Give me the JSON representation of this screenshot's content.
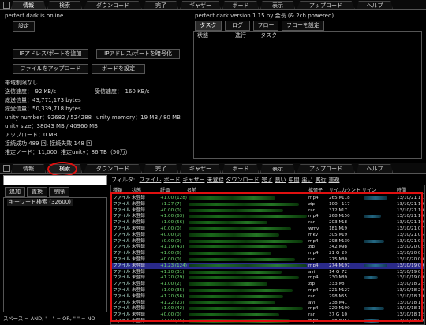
{
  "top_tabs": [
    "情報",
    "検索",
    "ダウンロード",
    "完了",
    "ギャザー",
    "ボード",
    "表示",
    "アップロード",
    "ヘルプ"
  ],
  "left_panel": {
    "status": "perfect dark is online.",
    "settings_button": "設定",
    "btn_add_ip": "IPアドレス/ポートを追加",
    "btn_encrypt_ip": "IPアドレス/ポートを暗号化",
    "btn_upload_file": "ファイルをアップロード",
    "btn_board_settings": "ボードを設定",
    "bandwidth": "帯域制限なし",
    "send_speed": "送信速度：　92 KB/s",
    "recv_speed": "受信速度：　160 KB/s",
    "total_sent": "総送信量：43,771,173 bytes",
    "total_recv": "総受信量：50,339,718 bytes",
    "unity_number": "unity number：92682 / 524288",
    "unity_memory": "unity memory：19 MB / 80 MB",
    "unity_size": "unity size：38043 MB / 40960 MB",
    "upload": "アップロード：0 MB",
    "connections": "接続成功 489 回, 接続失敗 148 回",
    "estimate": "推定ノード：11,000, 推定unity：86 TB（50万）"
  },
  "right_panel": {
    "version": "perfect dark version 1.15 by 金長 (& 2ch powered)",
    "tabs": [
      "タスク",
      "ログ",
      "フロー",
      "フローを設定"
    ],
    "columns": [
      "状態",
      "進行",
      "タスク"
    ]
  },
  "bottom_tabs": [
    "情報",
    "検索",
    "ダウンロード",
    "完了",
    "ギャザー",
    "ボード",
    "表示",
    "アップロード",
    "ヘルプ"
  ],
  "search_panel": {
    "buttons": [
      "追加",
      "置換",
      "削除"
    ],
    "keyword_item": "キーワード検索 (32600)",
    "hint": "スペース = AND, \" | \" = OR, \" \" = NO"
  },
  "filter_bar": {
    "label": "フィルタ:",
    "items": [
      "ファイル",
      "ボード",
      "ギャザー",
      "未登録",
      "ダウンロード",
      "完了",
      "良い",
      "中間",
      "悪い",
      "実行",
      "重複"
    ]
  },
  "columns": [
    "種類",
    "状態",
    "評価",
    "名前",
    "拡張子",
    "サイ..",
    "カウント",
    "サイン",
    "時間"
  ],
  "rows": [
    {
      "k": "ファイル",
      "s": "未登録",
      "r": "+1.00 (128)",
      "e": "mp4",
      "sz": "265 M",
      "c": "118",
      "t": "13/10/21 11:0"
    },
    {
      "k": "ファイル",
      "s": "未登録",
      "r": "+1.27 (7)",
      "e": "zip",
      "sz": "100",
      "c": "117",
      "t": "13/10/21 10:4"
    },
    {
      "k": "ファイル",
      "s": "未登録",
      "r": "+0.00 (0)",
      "e": "rar",
      "sz": "312 M",
      "c": "17",
      "t": "13/10/21 10:0"
    },
    {
      "k": "ファイル",
      "s": "未登録",
      "r": "+1.00 (63)",
      "e": "mp4",
      "sz": "268 M",
      "c": "150",
      "t": "13/10/21 10:0"
    },
    {
      "k": "ファイル",
      "s": "未登録",
      "r": "+1.00 (56)",
      "e": "rar",
      "sz": "203 M",
      "c": "18",
      "t": "13/10/21 10:0"
    },
    {
      "k": "ファイル",
      "s": "未登録",
      "r": "+0.00 (0)",
      "e": "wmv",
      "sz": "181 M",
      "c": "19",
      "t": "13/10/21 07:4"
    },
    {
      "k": "ファイル",
      "s": "未登録",
      "r": "+0.00 (0)",
      "e": "mkv",
      "sz": "305 M",
      "c": "19",
      "t": "13/10/21 05:3"
    },
    {
      "k": "ファイル",
      "s": "未登録",
      "r": "+0.00 (0)",
      "e": "mp4",
      "sz": "298 M",
      "c": "139",
      "t": "13/10/21 03:1"
    },
    {
      "k": "ファイル",
      "s": "未登録",
      "r": "+1.19 (43)",
      "e": "zip",
      "sz": "342 M",
      "c": "98",
      "t": "13/10/20 02:4"
    },
    {
      "k": "ファイル",
      "s": "未登録",
      "r": "+1.00 (6)",
      "e": "mp4",
      "sz": "21 G",
      "c": "29",
      "t": "13/10/20 01:2"
    },
    {
      "k": "ファイル",
      "s": "未登録",
      "r": "+0.00 (0)",
      "e": "rar",
      "sz": "275 M",
      "c": "30",
      "t": "13/10/20 00:0"
    },
    {
      "k": "ファイル",
      "s": "未登録",
      "r": "+1.23 (124)",
      "e": "mp4",
      "sz": "274 M",
      "c": "197",
      "t": "13/10/19 09:0"
    },
    {
      "k": "ファイル",
      "s": "未登録",
      "r": "+1.20 (31)",
      "e": "avi",
      "sz": "14 G",
      "c": "72",
      "t": "13/10/19 01:1"
    },
    {
      "k": "ファイル",
      "s": "未登録",
      "r": "+1.20 (29)",
      "e": "mp4",
      "sz": "230 M",
      "c": "89",
      "t": "13/10/19 00:0"
    },
    {
      "k": "ファイル",
      "s": "未登録",
      "r": "+1.00 (2)",
      "e": "zip",
      "sz": "333 M",
      "c": "8",
      "t": "13/10/18 22:4"
    },
    {
      "k": "ファイル",
      "s": "未登録",
      "r": "+1.00 (35)",
      "e": "mp4",
      "sz": "221 M",
      "c": "127",
      "t": "13/10/18 20:0"
    },
    {
      "k": "ファイル",
      "s": "未登録",
      "r": "+1.20 (56)",
      "e": "rar",
      "sz": "298 M",
      "c": "55",
      "t": "13/10/18 19:4"
    },
    {
      "k": "ファイル",
      "s": "未登録",
      "r": "+1.22 (23)",
      "e": "avi",
      "sz": "238 M",
      "c": "41",
      "t": "13/10/18 15:0"
    },
    {
      "k": "ファイル",
      "s": "未登録",
      "r": "+1.00 (42)",
      "e": "mp4",
      "sz": "229 M",
      "c": "190",
      "t": "13/10/18 14:0"
    },
    {
      "k": "ファイル",
      "s": "未登録",
      "r": "+0.00 (0)",
      "e": "rar",
      "sz": "37 G",
      "c": "10",
      "t": "13/10/18 12:0"
    },
    {
      "k": "ファイル",
      "s": "未登録",
      "r": "+1.00 (25)",
      "e": "mp4",
      "sz": "248 M",
      "c": "251",
      "t": "13/10/18 09:0"
    }
  ],
  "colors": {
    "highlight_row": "#2a2a8a",
    "status_green": "#6fdc6f",
    "annotation_red": "#e01010"
  }
}
